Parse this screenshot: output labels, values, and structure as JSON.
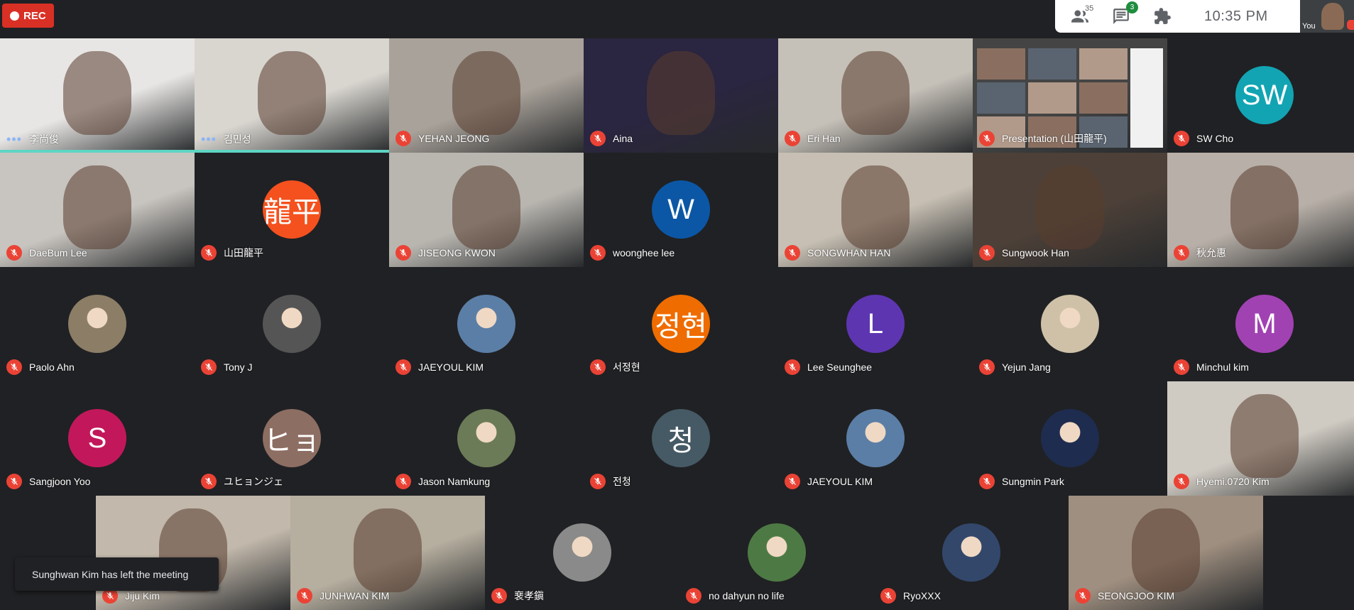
{
  "recording": {
    "label": "REC"
  },
  "toolbar": {
    "participants_count": "35",
    "chat_unread": "3",
    "time": "10:35 PM"
  },
  "self_view": {
    "label": "You"
  },
  "toast": {
    "message": "Sunghwan Kim has left the meeting"
  },
  "participants": [
    {
      "name": "李尚俊",
      "tile": "video",
      "bg": "#e8e6e4",
      "speaking": true
    },
    {
      "name": "김민성",
      "tile": "video",
      "bg": "#d9d6d0",
      "speaking": true
    },
    {
      "name": "YEHAN JEONG",
      "tile": "video",
      "bg": "#a9a29a"
    },
    {
      "name": "Aina",
      "tile": "video",
      "bg": "#2a2540"
    },
    {
      "name": "Eri Han",
      "tile": "video",
      "bg": "#c5c0b8"
    },
    {
      "name": "Presentation (山田龍平)",
      "tile": "presentation",
      "bg": "#444"
    },
    {
      "name": "SW Cho",
      "tile": "avatar",
      "initials": "SW",
      "color": "#12a4b3"
    },
    {
      "name": "DaeBum Lee",
      "tile": "video",
      "bg": "#c8c4bf"
    },
    {
      "name": "山田龍平",
      "tile": "avatar",
      "initials": "龍平",
      "color": "#f4511e"
    },
    {
      "name": "JISEONG KWON",
      "tile": "video",
      "bg": "#b9b6b0"
    },
    {
      "name": "woonghee lee",
      "tile": "avatar",
      "initials": "W",
      "color": "#0b57a5"
    },
    {
      "name": "SONGWHAN HAN",
      "tile": "video",
      "bg": "#c7bfb3"
    },
    {
      "name": "Sungwook Han",
      "tile": "video",
      "bg": "#4c4038"
    },
    {
      "name": "秋允惠",
      "tile": "video",
      "bg": "#b8b0a8"
    },
    {
      "name": "Paolo Ahn",
      "tile": "avatar",
      "photo": true,
      "color": "#8c7d66"
    },
    {
      "name": "Tony J",
      "tile": "avatar",
      "photo": true,
      "color": "#555"
    },
    {
      "name": "JAEYOUL KIM",
      "tile": "avatar",
      "photo": true,
      "color": "#5b7ea6"
    },
    {
      "name": "서정현",
      "tile": "avatar",
      "initials": "정현",
      "color": "#ef6c00"
    },
    {
      "name": "Lee Seunghee",
      "tile": "avatar",
      "initials": "L",
      "color": "#5e35b1"
    },
    {
      "name": "Yejun Jang",
      "tile": "avatar",
      "photo": true,
      "color": "#cfc1a8"
    },
    {
      "name": "Minchul kim",
      "tile": "avatar",
      "initials": "M",
      "color": "#a142b3"
    },
    {
      "name": "Sangjoon Yoo",
      "tile": "avatar",
      "initials": "S",
      "color": "#c2185b"
    },
    {
      "name": "ユヒョンジェ",
      "tile": "avatar",
      "initials": "ヒョ",
      "color": "#8d6e63"
    },
    {
      "name": "Jason Namkung",
      "tile": "avatar",
      "photo": true,
      "color": "#6b7b57"
    },
    {
      "name": "전청",
      "tile": "avatar",
      "initials": "청",
      "color": "#455a64"
    },
    {
      "name": "JAEYOUL KIM",
      "tile": "avatar",
      "photo": true,
      "color": "#5b7ea6"
    },
    {
      "name": "Sungmin Park",
      "tile": "avatar",
      "photo": true,
      "color": "#1e2c4f"
    },
    {
      "name": "Hyemi.0720 Kim",
      "tile": "video",
      "bg": "#cfcac2"
    },
    {
      "name": "Jiju Kim",
      "tile": "video",
      "bg": "#c2b8ab"
    },
    {
      "name": "JUNHWAN KIM",
      "tile": "video",
      "bg": "#b6ae9f"
    },
    {
      "name": "裵孝鎭",
      "tile": "avatar",
      "photo": true,
      "color": "#8a8a8a"
    },
    {
      "name": "no dahyun no life",
      "tile": "avatar",
      "photo": true,
      "color": "#4d7a44"
    },
    {
      "name": "RyoXXX",
      "tile": "avatar",
      "photo": true,
      "color": "#33476b"
    },
    {
      "name": "SEONGJOO KIM",
      "tile": "video",
      "bg": "#9f8f80"
    }
  ]
}
